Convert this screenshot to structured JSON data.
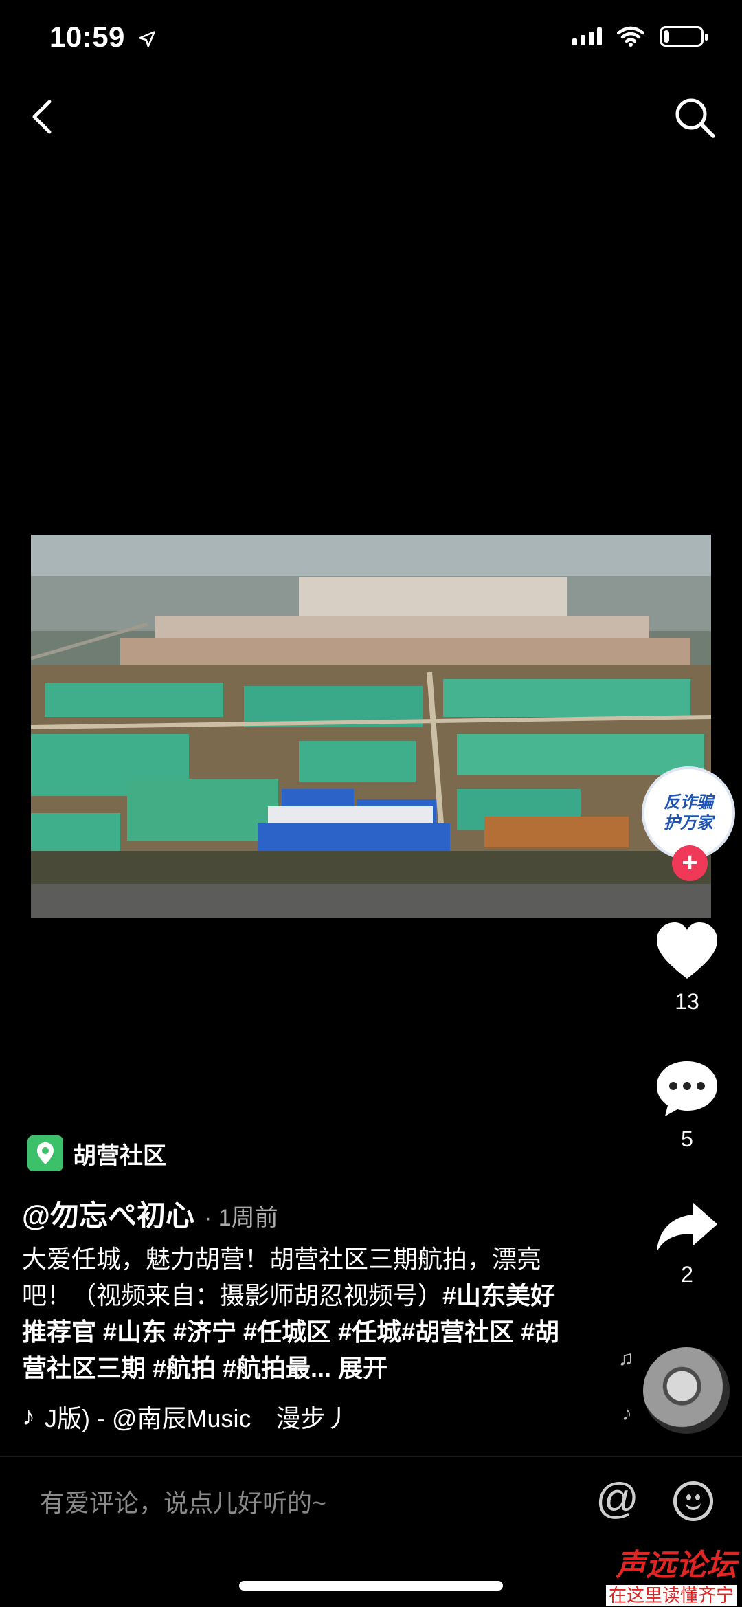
{
  "status_bar": {
    "time": "10:59",
    "battery_level": 0.15
  },
  "video": {
    "colors": {
      "sky": "#a7b3b5",
      "field": "#3fae8a",
      "soil": "#a8703f",
      "roof": "#2b63c9"
    }
  },
  "badge": {
    "line1": "反诈骗",
    "line2": "护万家"
  },
  "actions": {
    "likes": "13",
    "comments": "5",
    "shares": "2"
  },
  "location": {
    "name": "胡营社区"
  },
  "author": {
    "handle": "@勿忘ぺ初心",
    "time_ago": "· 1周前"
  },
  "description": {
    "text": "大爱任城，魅力胡营！胡营社区三期航拍，漂亮吧！（视频来自：摄影师胡忍视频号）",
    "tags": "#山东美好推荐官 #山东 #济宁 #任城区 #任城#胡营社区 #胡营社区三期 #航拍 #航拍最...",
    "expand_label": "展开"
  },
  "music": {
    "text": "J版) - @南辰Music　漫步丿"
  },
  "comment_bar": {
    "placeholder": "有爱评论，说点儿好听的~",
    "at_symbol": "@"
  },
  "watermark": {
    "line1": "声远论坛",
    "line2": "在这里读懂齐宁"
  }
}
